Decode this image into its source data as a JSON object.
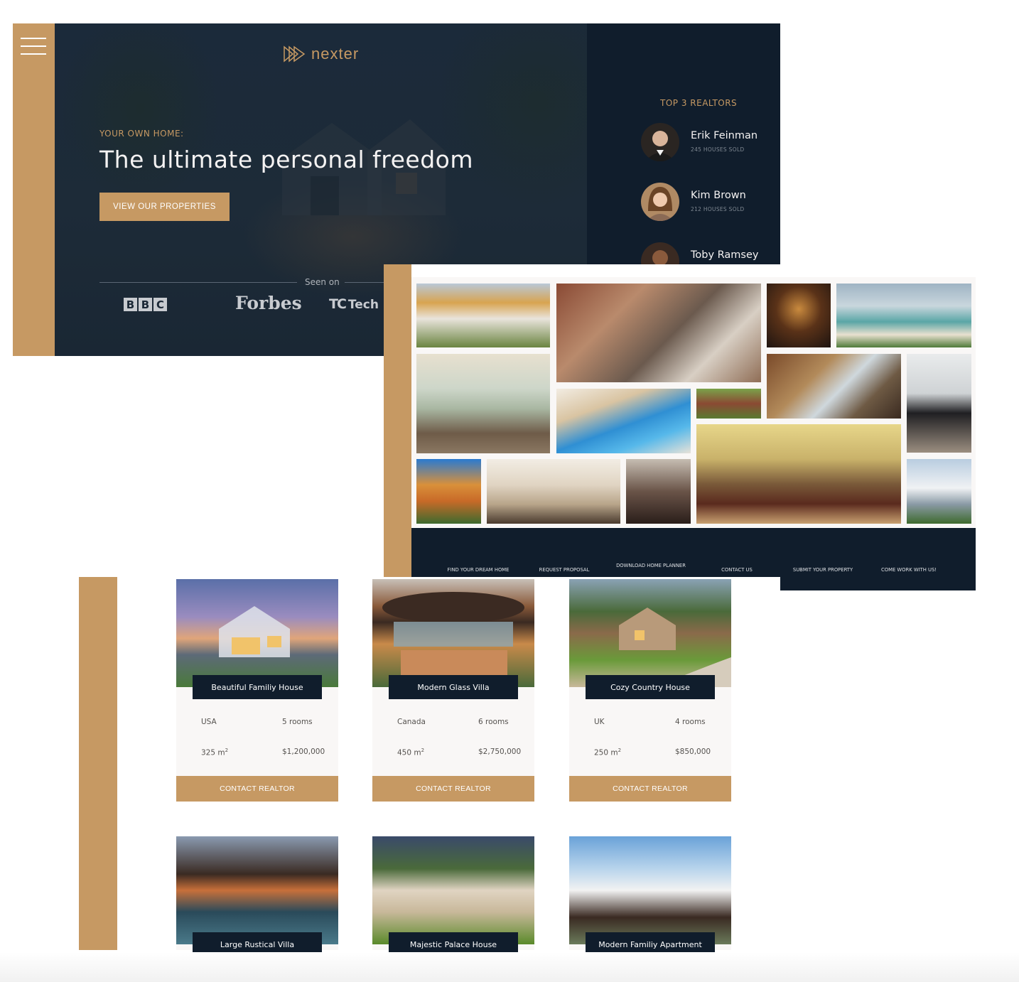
{
  "hero": {
    "logo_text": "nexter",
    "eyebrow": "YOUR OWN HOME:",
    "headline": "The ultimate personal freedom",
    "cta_label": "VIEW OUR PROPERTIES",
    "seen_on": "Seen on",
    "brands": {
      "bbc": [
        "B",
        "B",
        "C"
      ],
      "forbes": "Forbes",
      "techcrunch": "Tech"
    }
  },
  "realtors": {
    "title": "TOP 3 REALTORS",
    "items": [
      {
        "name": "Erik Feinman",
        "sold": "245 HOUSES SOLD"
      },
      {
        "name": "Kim Brown",
        "sold": "212 HOUSES SOLD"
      },
      {
        "name": "Toby Ramsey",
        "sold": ""
      }
    ]
  },
  "footer": {
    "links": [
      {
        "label": "FIND YOUR DREAM HOME"
      },
      {
        "label": "REQUEST PROPOSAL"
      },
      {
        "label": "DOWNLOAD HOME PLANNER"
      },
      {
        "label": "CONTACT US"
      },
      {
        "label": "SUBMIT YOUR PROPERTY"
      },
      {
        "label": "COME WORK WITH US!"
      }
    ]
  },
  "homes": [
    {
      "name": "Beautiful Familiy House",
      "location": "USA",
      "rooms": "5 rooms",
      "area": "325 m",
      "area_unit_sup": "2",
      "price": "$1,200,000",
      "cta": "CONTACT REALTOR"
    },
    {
      "name": "Modern Glass Villa",
      "location": "Canada",
      "rooms": "6 rooms",
      "area": "450 m",
      "area_unit_sup": "2",
      "price": "$2,750,000",
      "cta": "CONTACT REALTOR"
    },
    {
      "name": "Cozy Country House",
      "location": "UK",
      "rooms": "4 rooms",
      "area": "250 m",
      "area_unit_sup": "2",
      "price": "$850,000",
      "cta": "CONTACT REALTOR"
    },
    {
      "name": "Large Rustical Villa"
    },
    {
      "name": "Majestic Palace House"
    },
    {
      "name": "Modern Familiy Apartment"
    }
  ],
  "colors": {
    "primary_navy": "#101d2c",
    "accent_gold": "#c69963",
    "light_bg": "#f9f7f6",
    "text_light": "#f4f2f2"
  },
  "icons": [
    "hamburger-menu-icon",
    "nexter-logo-icon"
  ]
}
